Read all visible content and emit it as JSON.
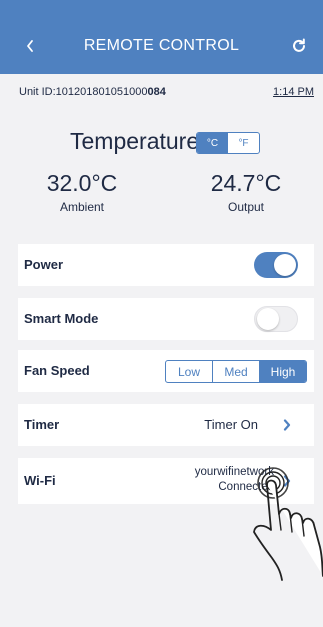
{
  "header": {
    "title": "REMOTE CONTROL",
    "back_icon": "chevron-left-icon",
    "refresh_icon": "refresh-icon",
    "color": "#4f81c0"
  },
  "unit": {
    "prefix": "Unit ID:101201801051000",
    "suffix_bold": "084",
    "time": "1:14 PM"
  },
  "temperature": {
    "title": "Temperature",
    "units": [
      "°C",
      "°F"
    ],
    "selected_unit": "°C",
    "ambient_value": "32.0°C",
    "ambient_label": "Ambient",
    "output_value": "24.7°C",
    "output_label": "Output"
  },
  "controls": {
    "power": {
      "label": "Power",
      "state": "on"
    },
    "smart_mode": {
      "label": "Smart Mode",
      "state": "off"
    },
    "fan_speed": {
      "label": "Fan Speed",
      "options": [
        "Low",
        "Med",
        "High"
      ],
      "selected": "High"
    },
    "timer": {
      "label": "Timer",
      "value": "Timer On"
    },
    "wifi": {
      "label": "Wi-Fi",
      "network": "yourwifinetwork",
      "status": "Connected"
    }
  }
}
